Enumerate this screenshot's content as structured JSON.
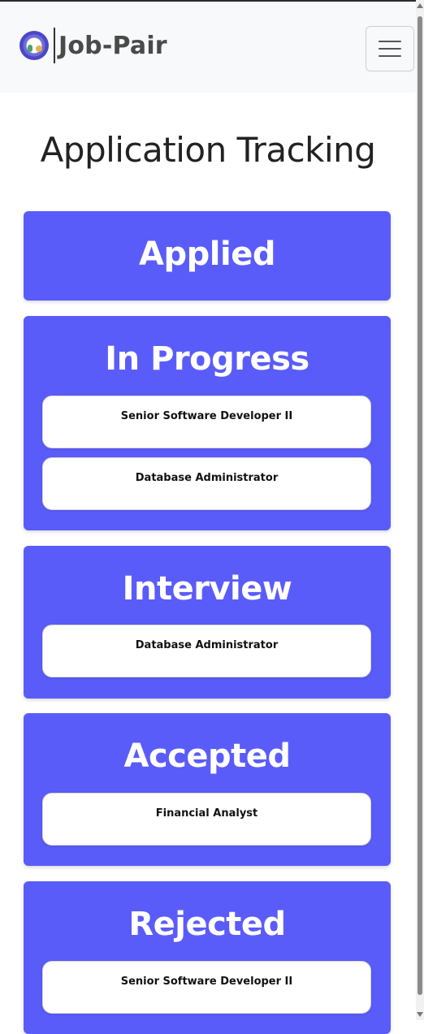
{
  "navbar": {
    "brand_text": "Job-Pair",
    "logo_icon": "job-pair-logo-icon",
    "menu_icon": "hamburger-menu-icon"
  },
  "page": {
    "title": "Application Tracking"
  },
  "columns": [
    {
      "heading": "Applied",
      "jobs": []
    },
    {
      "heading": "In Progress",
      "jobs": [
        "Senior Software Developer II",
        "Database Administrator"
      ]
    },
    {
      "heading": "Interview",
      "jobs": [
        "Database Administrator"
      ]
    },
    {
      "heading": "Accepted",
      "jobs": [
        "Financial Analyst"
      ]
    },
    {
      "heading": "Rejected",
      "jobs": [
        "Senior Software Developer II"
      ]
    }
  ],
  "colors": {
    "column_background": "#5a5cfa",
    "navbar_background": "#f8f9fa",
    "card_background": "#ffffff"
  }
}
